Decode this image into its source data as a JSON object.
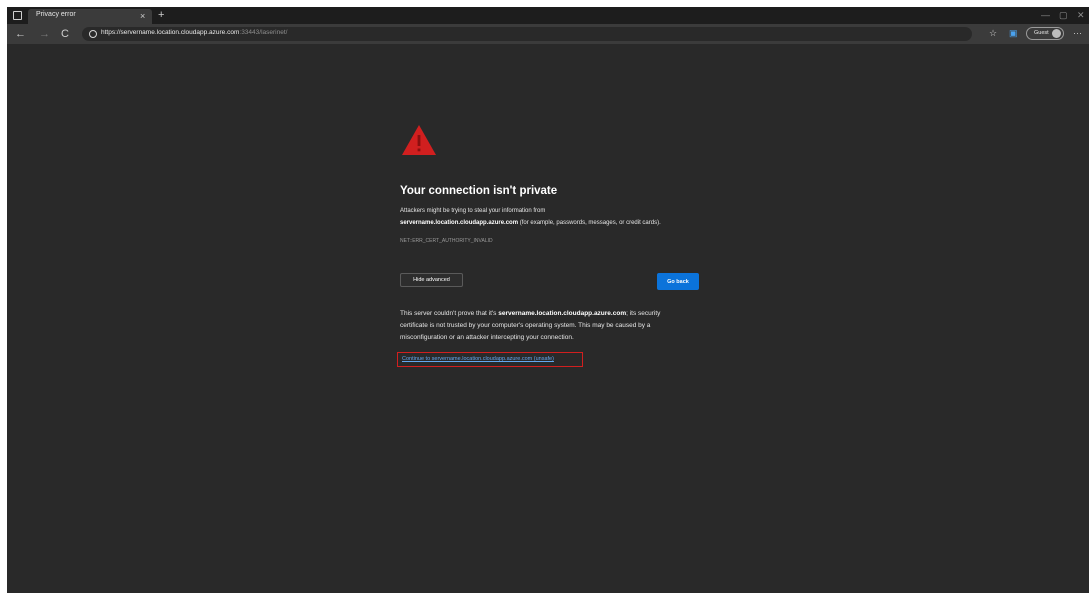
{
  "browser": {
    "tab_title": "Privacy error",
    "tab_close": "×",
    "new_tab": "+",
    "window_controls": {
      "minimize": "—",
      "maximize": "▢",
      "close": "✕"
    },
    "nav": {
      "back": "←",
      "forward": "→",
      "refresh": "C"
    },
    "address": {
      "host": "https://servername.location.cloudapp.azure.com",
      "rest": ":33443/laserinet/"
    },
    "toolbar": {
      "favorites_icon": "☆",
      "collections_icon": "▣",
      "profile_label": "Guest",
      "more_icon": "···"
    }
  },
  "error_page": {
    "heading": "Your connection isn't private",
    "intro_line1": "Attackers might be trying to steal your information from",
    "host_bold": "servername.location.cloudapp.azure.com",
    "intro_line2_rest": " (for example, passwords, messages, or credit cards).",
    "error_code": "NET::ERR_CERT_AUTHORITY_INVALID",
    "hide_advanced_label": "Hide advanced",
    "go_back_label": "Go back",
    "advanced_line1_start": "This server couldn't prove that it's ",
    "advanced_line1_end": "; its security",
    "advanced_line2": "certificate is not trusted by your computer's operating system. This may be caused by a",
    "advanced_line3": "misconfiguration or an attacker intercepting your connection.",
    "continue_link": "Continue to servername.location.cloudapp.azure.com (unsafe)"
  },
  "colors": {
    "page_bg": "#292929",
    "warning_red": "#d11f1f",
    "button_blue": "#0b73da",
    "link_blue": "#62a8ef"
  },
  "icons": [
    "window-menu-icon",
    "globe-icon",
    "warning-triangle-icon",
    "favorites-star-icon",
    "collections-icon",
    "guest-avatar-icon"
  ]
}
